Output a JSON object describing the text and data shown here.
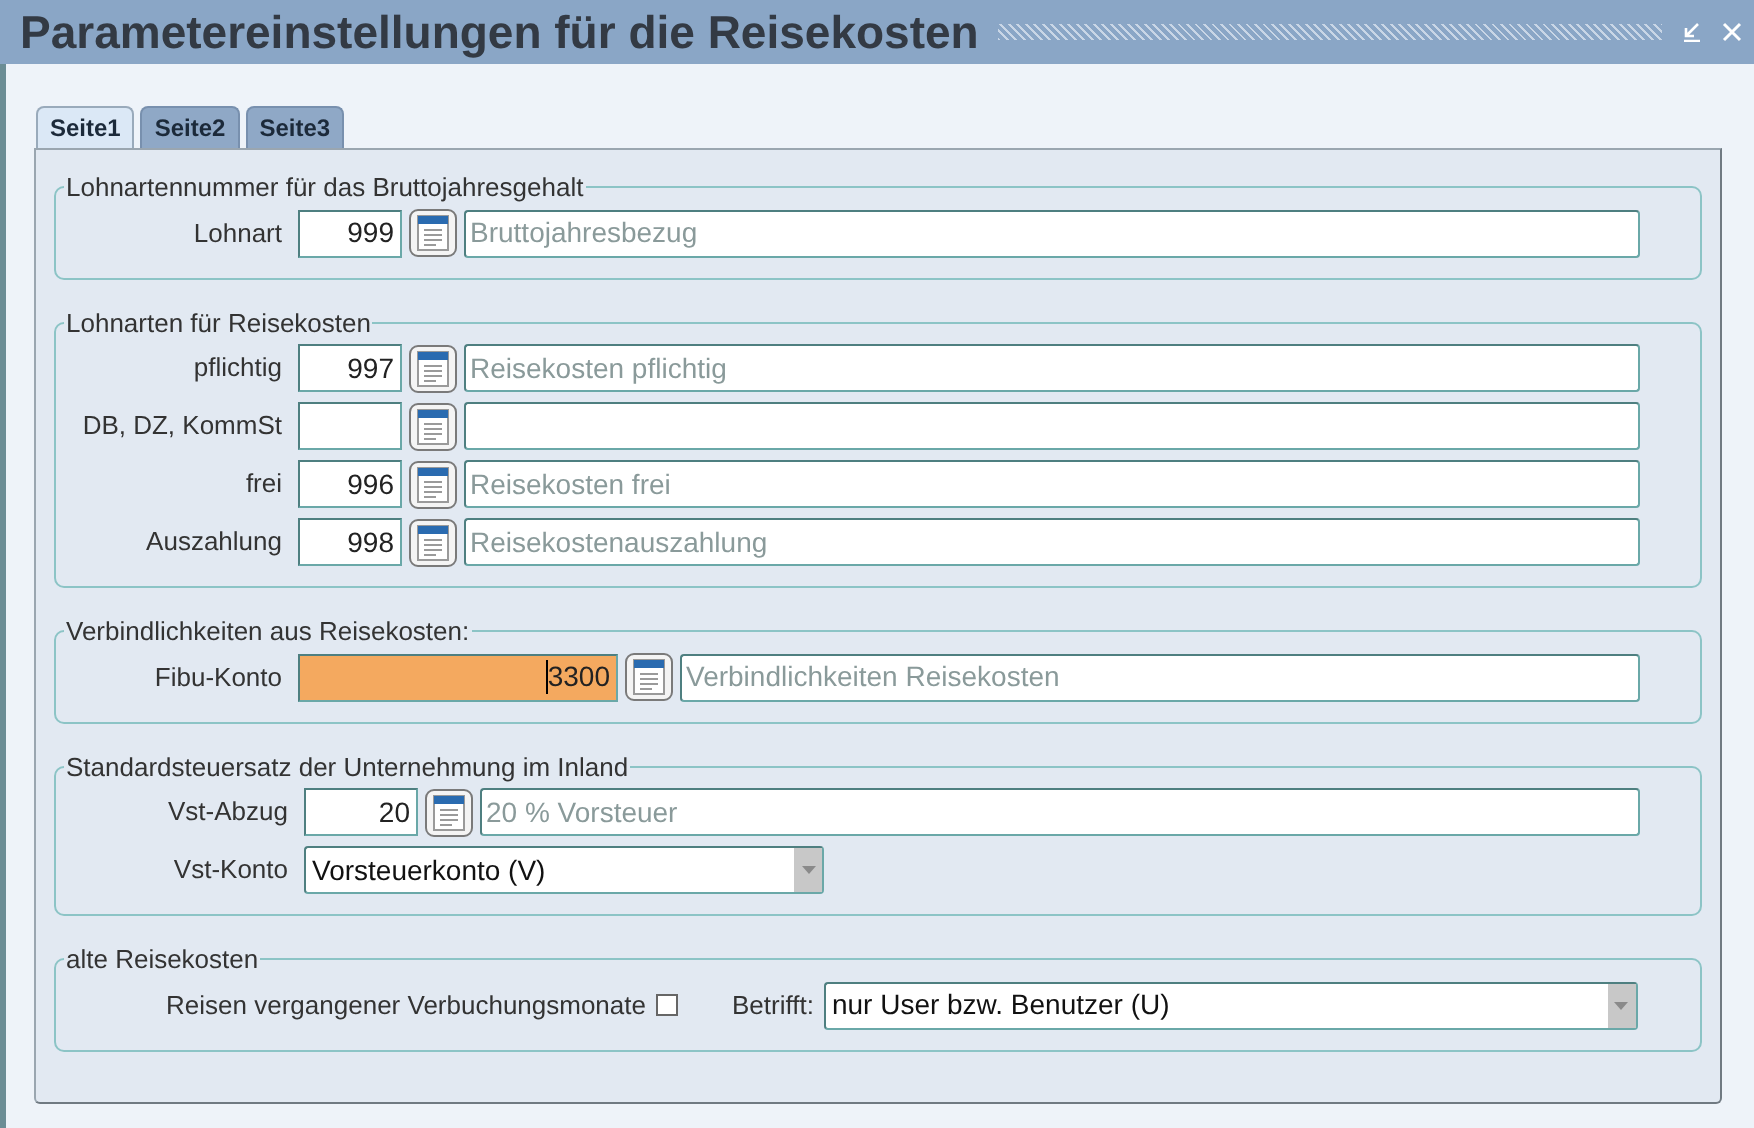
{
  "window": {
    "title": "Parametereinstellungen für die Reisekosten"
  },
  "tabs": [
    {
      "label": "Seite1",
      "selected": true
    },
    {
      "label": "Seite2",
      "selected": false
    },
    {
      "label": "Seite3",
      "selected": false
    }
  ],
  "sections": [
    {
      "title": "Lohnartennummer für das Bruttojahresgehalt",
      "rows": [
        {
          "kind": "lookup",
          "label": "Lohnart",
          "code": "999",
          "description": "Bruttojahresbezug",
          "focused": false
        }
      ]
    },
    {
      "title": "Lohnarten für Reisekosten",
      "rows": [
        {
          "kind": "lookup",
          "label": "pflichtig",
          "code": "997",
          "description": "Reisekosten pflichtig",
          "focused": false
        },
        {
          "kind": "lookup",
          "label": "DB, DZ, KommSt",
          "focused": false
        },
        {
          "kind": "lookup",
          "label": "frei",
          "code": "996",
          "description": "Reisekosten frei",
          "focused": false
        },
        {
          "kind": "lookup",
          "label": "Auszahlung",
          "code": "998",
          "description": "Reisekostenauszahlung",
          "focused": false
        }
      ]
    },
    {
      "title": "Verbindlichkeiten aus Reisekosten:",
      "rows": [
        {
          "kind": "lookup",
          "label": "Fibu-Konto",
          "code": "3300",
          "description": "Verbindlichkeiten Reisekosten",
          "focused": true
        }
      ]
    },
    {
      "title": "Standardsteuersatz der Unternehmung im Inland",
      "rows": [
        {
          "kind": "lookup",
          "label": "Vst-Abzug",
          "code": "20",
          "description": "20 % Vorsteuer",
          "focused": false
        },
        {
          "kind": "select",
          "label": "Vst-Konto",
          "value": "Vorsteuerkonto (V)"
        }
      ]
    },
    {
      "title": "alte Reisekosten",
      "rows": [
        {
          "kind": "checkbox_select",
          "label": "Reisen vergangener Verbuchungsmonate",
          "checked": false,
          "select_label": "Betrifft:",
          "value": "nur User bzw. Benutzer (U)"
        }
      ]
    }
  ]
}
